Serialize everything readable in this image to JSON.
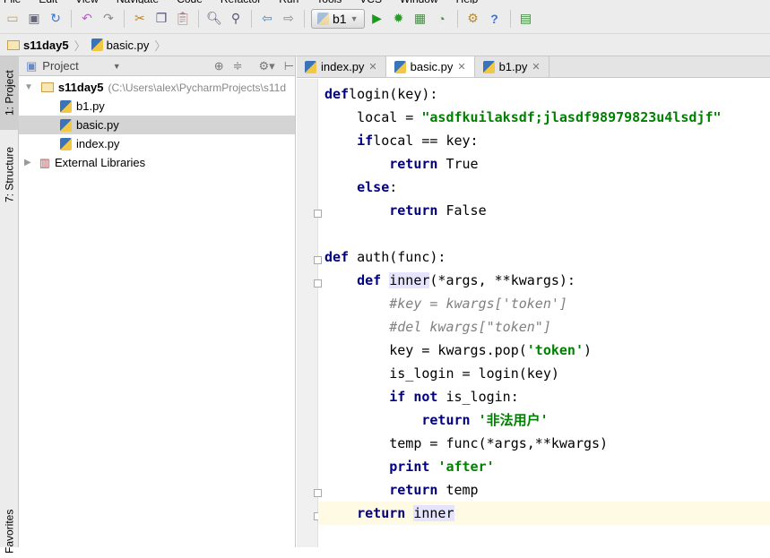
{
  "menu": [
    "File",
    "Edit",
    "View",
    "Navigate",
    "Code",
    "Refactor",
    "Run",
    "Tools",
    "VCS",
    "Window",
    "Help"
  ],
  "toolbar": {
    "run_config": "b1",
    "icons": [
      "open-icon",
      "save-icon",
      "sync-icon",
      "undo-icon",
      "redo-icon",
      "cut-icon",
      "copy-icon",
      "paste-icon",
      "find-icon",
      "replace-icon",
      "back-icon",
      "forward-icon",
      "run-icon",
      "debug-icon",
      "coverage-icon",
      "profile-icon",
      "settings-icon",
      "help-icon",
      "sdk-icon"
    ]
  },
  "breadcrumb": {
    "project": "s11day5",
    "file": "basic.py"
  },
  "left_strip": {
    "project_tab": "1: Project",
    "structure_tab": "7: Structure",
    "favorites_tab": "Favorites"
  },
  "project_panel": {
    "title": "Project",
    "root": {
      "name": "s11day5",
      "path": "(C:\\Users\\alex\\PycharmProjects\\s11d"
    },
    "files": [
      "b1.py",
      "basic.py",
      "index.py"
    ],
    "selected": "basic.py",
    "external": "External Libraries"
  },
  "tabs": [
    {
      "label": "index.py",
      "active": false
    },
    {
      "label": "basic.py",
      "active": true
    },
    {
      "label": "b1.py",
      "active": false
    }
  ],
  "code": [
    [
      [
        "kw",
        "def"
      ],
      [
        "",
        "login(key):"
      ]
    ],
    [
      [
        "",
        "    local = "
      ],
      [
        "str",
        "\"asdfkuilaksdf;jlasdf98979823u4lsdjf\""
      ]
    ],
    [
      [
        "",
        "    "
      ],
      [
        "kw",
        "if"
      ],
      [
        "",
        "local == key:"
      ]
    ],
    [
      [
        "",
        "        "
      ],
      [
        "kw",
        "return"
      ],
      [
        "",
        " True"
      ]
    ],
    [
      [
        "",
        "    "
      ],
      [
        "kw",
        "else"
      ],
      [
        "",
        ":"
      ]
    ],
    [
      [
        "",
        "        "
      ],
      [
        "kw",
        "return"
      ],
      [
        "",
        " False"
      ]
    ],
    [],
    [
      [
        "kw",
        "def"
      ],
      [
        "",
        " auth(func):"
      ]
    ],
    [
      [
        "",
        "    "
      ],
      [
        "kw",
        "def"
      ],
      [
        "",
        " "
      ],
      [
        "hl",
        "inner"
      ],
      [
        "",
        "(*args, **kwargs):"
      ]
    ],
    [
      [
        "",
        "        "
      ],
      [
        "cm",
        "#key = kwargs['token']"
      ]
    ],
    [
      [
        "",
        "        "
      ],
      [
        "cm",
        "#del kwargs[\"token\"]"
      ]
    ],
    [
      [
        "",
        "        key = kwargs.pop("
      ],
      [
        "str",
        "'token'"
      ],
      [
        "",
        ")"
      ]
    ],
    [
      [
        "",
        "        is_login = login(key)"
      ]
    ],
    [
      [
        "",
        "        "
      ],
      [
        "kw",
        "if not"
      ],
      [
        "",
        " is_login:"
      ]
    ],
    [
      [
        "",
        "            "
      ],
      [
        "kw",
        "return"
      ],
      [
        "",
        " "
      ],
      [
        "str",
        "'非法用户'"
      ]
    ],
    [
      [
        "",
        "        temp = func(*args,**kwargs)"
      ]
    ],
    [
      [
        "",
        "        "
      ],
      [
        "kw",
        "print"
      ],
      [
        "",
        " "
      ],
      [
        "str",
        "'after'"
      ]
    ],
    [
      [
        "",
        "        "
      ],
      [
        "kw",
        "return"
      ],
      [
        "",
        " temp"
      ]
    ],
    [
      [
        "",
        "    "
      ],
      [
        "kw",
        "return"
      ],
      [
        "",
        " "
      ],
      [
        "hl",
        "inner"
      ]
    ]
  ],
  "current_line": 18
}
